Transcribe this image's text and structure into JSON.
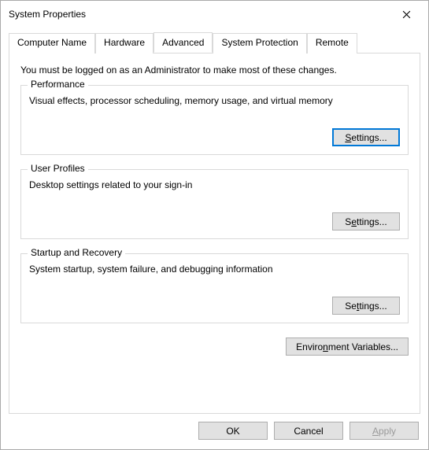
{
  "window": {
    "title": "System Properties"
  },
  "tabs": {
    "computer_name": "Computer Name",
    "hardware": "Hardware",
    "advanced": "Advanced",
    "system_protection": "System Protection",
    "remote": "Remote"
  },
  "panel": {
    "admin_message": "You must be logged on as an Administrator to make most of these changes.",
    "performance": {
      "title": "Performance",
      "desc": "Visual effects, processor scheduling, memory usage, and virtual memory",
      "settings_prefix": "S",
      "settings_rest": "ettings..."
    },
    "user_profiles": {
      "title": "User Profiles",
      "desc": "Desktop settings related to your sign-in",
      "settings_prefix": "Settings...",
      "settings_u": "e"
    },
    "startup_recovery": {
      "title": "Startup and Recovery",
      "desc": "System startup, system failure, and debugging information",
      "settings_prefix": "Settings...",
      "settings_u": "t"
    },
    "env_button_prefix": "Enviro",
    "env_button_u": "n",
    "env_button_rest": "ment Variables..."
  },
  "buttons": {
    "ok": "OK",
    "cancel": "Cancel",
    "apply_u": "A",
    "apply_rest": "pply"
  }
}
